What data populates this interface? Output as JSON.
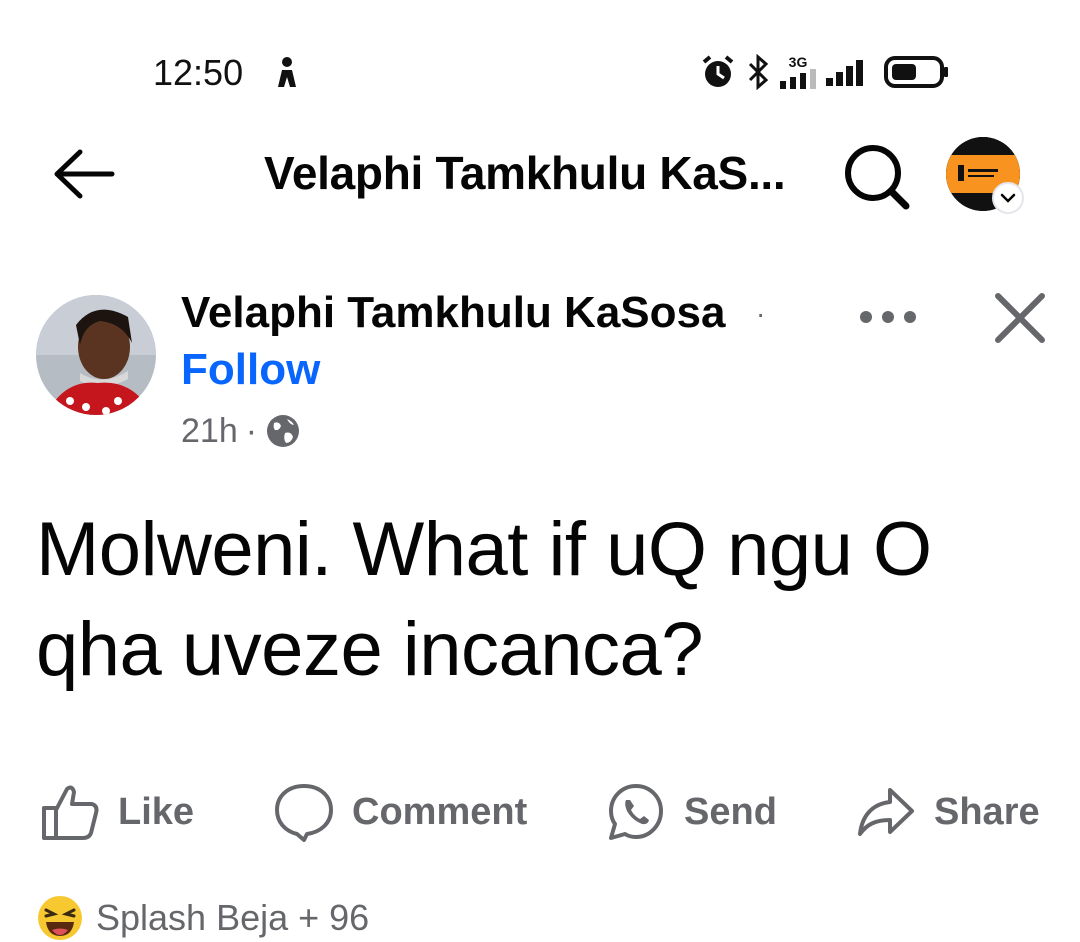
{
  "status_bar": {
    "time": "12:50",
    "network_label": "3G",
    "icons": [
      "person-icon",
      "alarm-icon",
      "bluetooth-icon",
      "network-3g-icon",
      "signal-icon",
      "battery-icon"
    ]
  },
  "header": {
    "title": "Velaphi Tamkhulu KaS...",
    "back_icon": "arrow-left-icon",
    "search_icon": "search-icon"
  },
  "post": {
    "author_name": "Velaphi Tamkhulu KaSosa",
    "separator": "·",
    "follow_label": "Follow",
    "time": "21h",
    "meta_separator": "·",
    "audience_icon": "globe-icon",
    "text": "Molweni. What if uQ ngu O qha uveze incanca?"
  },
  "actions": {
    "like": "Like",
    "comment": "Comment",
    "send": "Send",
    "share": "Share"
  },
  "reactions": {
    "emoji": "laughing-emoji-icon",
    "summary": "Splash Beja + 96"
  },
  "colors": {
    "link_blue": "#0866ff",
    "secondary_text": "#65676b",
    "primary_text": "#050505",
    "avatar_orange": "#f7931e"
  }
}
